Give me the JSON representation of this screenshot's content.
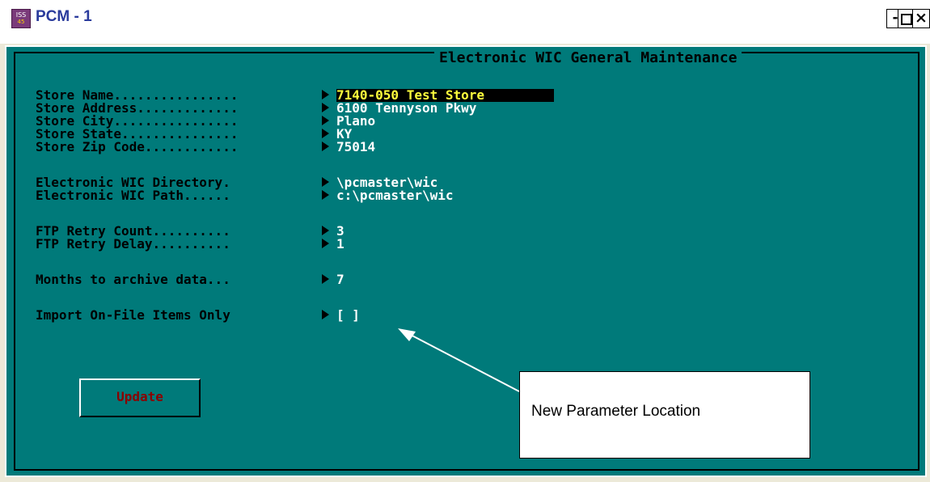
{
  "window": {
    "title": "PCM - 1",
    "icon": "iss-app-icon",
    "icon_text_top": "ISS",
    "icon_text_bottom": "45",
    "controls": {
      "minimize": "-",
      "maximize": "□",
      "close": "×"
    }
  },
  "screen": {
    "heading": "Electronic WIC General Maintenance",
    "fields": [
      {
        "label": "Store Name................",
        "value": "7140-050 Test Store",
        "selected": true
      },
      {
        "label": "Store Address.............",
        "value": "6100 Tennyson Pkwy"
      },
      {
        "label": "Store City................",
        "value": "Plano"
      },
      {
        "label": "Store State...............",
        "value": "KY"
      },
      {
        "label": "Store Zip Code............",
        "value": "75014"
      },
      {
        "label": "Electronic WIC Directory.",
        "value": "\\pcmaster\\wic"
      },
      {
        "label": "Electronic WIC Path......",
        "value": "c:\\pcmaster\\wic"
      },
      {
        "label": "FTP Retry Count..........",
        "value": "3"
      },
      {
        "label": "FTP Retry Delay..........",
        "value": "1"
      },
      {
        "label": "Months to archive data...",
        "value": "7"
      },
      {
        "label": "Import On-File Items Only",
        "value": "[ ]"
      }
    ],
    "update_button": "Update"
  },
  "annotation": {
    "text": "New Parameter Location"
  },
  "colors": {
    "console_bg": "#007a7a",
    "value_text": "#ffffff",
    "selected_text": "#ffff3c",
    "button_text": "#8a0000",
    "title_text": "#2a3b9c"
  }
}
